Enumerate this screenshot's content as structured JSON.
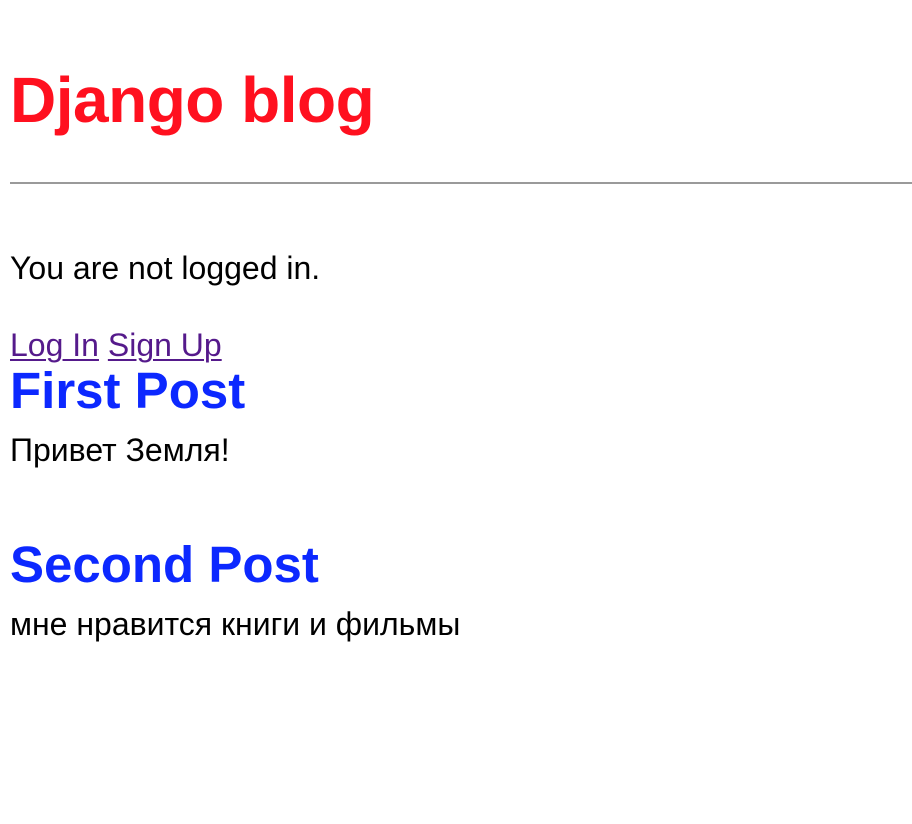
{
  "site": {
    "title": "Django blog",
    "title_color": "#ff101f"
  },
  "auth": {
    "status_text": "You are not logged in.",
    "login_label": "Log In",
    "signup_label": "Sign Up",
    "link_color": "#551a8b"
  },
  "posts": [
    {
      "title": "First Post",
      "body": "Привет Земля!"
    },
    {
      "title": "Second Post",
      "body": "мне нравится книги и фильмы"
    }
  ],
  "colors": {
    "post_title": "#0c28ff",
    "divider": "#9a9a9a",
    "text": "#000000"
  }
}
